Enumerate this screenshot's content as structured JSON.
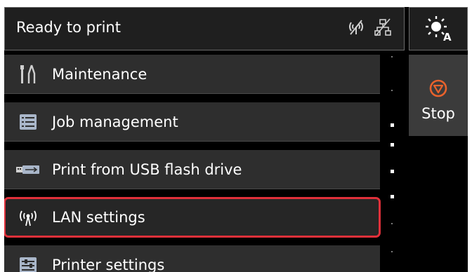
{
  "status_bar": {
    "text": "Ready to print",
    "icons": [
      "wireless-off-icon",
      "wired-lan-off-icon"
    ]
  },
  "ambient_button": {
    "icon": "brightness-auto-icon"
  },
  "menu": {
    "items": [
      {
        "label": "Maintenance",
        "icon": "maintenance-tools-icon"
      },
      {
        "label": "Job management",
        "icon": "job-list-icon"
      },
      {
        "label": "Print from USB flash drive",
        "icon": "usb-flash-drive-icon"
      },
      {
        "label": "LAN settings",
        "icon": "antenna-icon",
        "selected": true
      },
      {
        "label": "Printer settings",
        "icon": "printer-settings-icon"
      }
    ]
  },
  "stop_button": {
    "label": "Stop",
    "icon": "stop-icon",
    "icon_color": "#e8622c"
  },
  "colors": {
    "highlight": "#e0303a",
    "item_bg": "#2e2e2e",
    "screen_bg": "#000000"
  }
}
